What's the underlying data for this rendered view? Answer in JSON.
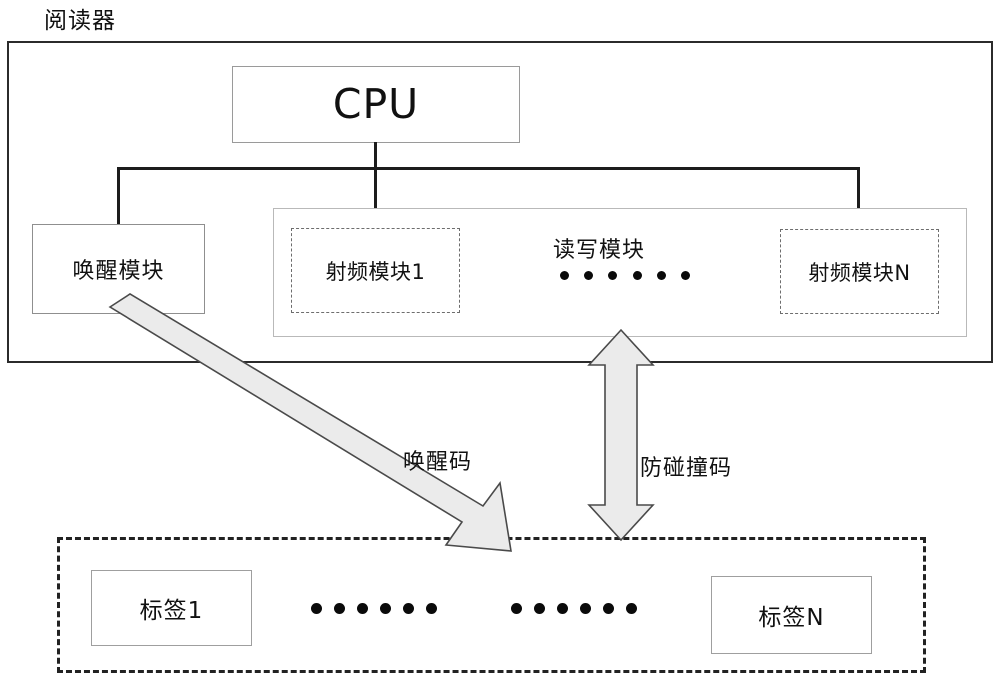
{
  "diagram": {
    "title": "阅读器",
    "reader": {
      "cpu": {
        "label": "CPU"
      },
      "wake_module": {
        "label": "唤醒模块"
      },
      "read_write_module": {
        "title": "读写模块",
        "ellipsis_dot_count": 6,
        "rf_modules": [
          {
            "label": "射频模块1"
          },
          {
            "label": "射频模块N"
          }
        ]
      }
    },
    "tags_group": {
      "tags": [
        {
          "label": "标签1"
        },
        {
          "label": "标签N"
        }
      ],
      "ellipsis_groups": [
        {
          "dot_count": 6
        },
        {
          "dot_count": 6
        }
      ]
    },
    "arrows": [
      {
        "name": "wake-code-arrow",
        "label": "唤醒码",
        "direction": "one-way",
        "from": "唤醒模块",
        "to": "标签组"
      },
      {
        "name": "anti-collision-code-arrow",
        "label": "防碰撞码",
        "direction": "two-way",
        "from": "读写模块",
        "to": "标签组"
      }
    ],
    "colors": {
      "reader_border": "#2b2b2b",
      "inner_box_border": "#9a9a9a",
      "dashed_border": "#6d6d6d",
      "tags_dashed_border": "#222222",
      "line": "#1c1c1c",
      "arrow_fill": "#ebebeb",
      "arrow_stroke": "#4a4a4a",
      "text": "#111111",
      "background": "#ffffff"
    }
  }
}
